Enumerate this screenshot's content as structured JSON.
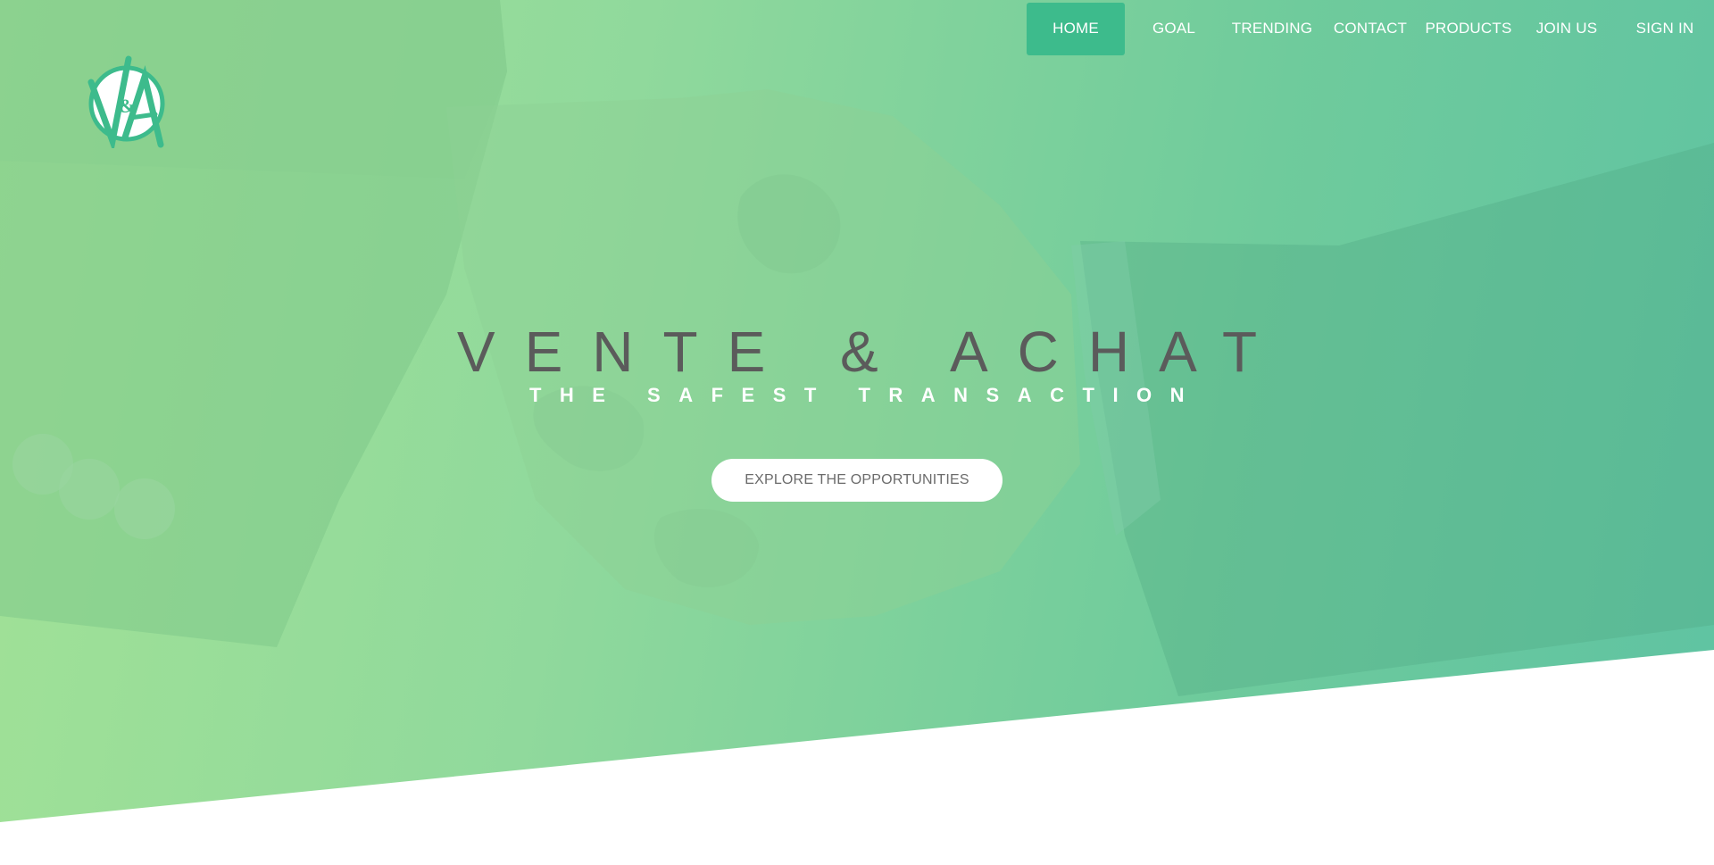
{
  "header": {
    "logo_text": "V&A",
    "nav": [
      {
        "label": "HOME",
        "active": true
      },
      {
        "label": "GOAL",
        "active": false
      },
      {
        "label": "TRENDING",
        "active": false
      },
      {
        "label": "CONTACT",
        "active": false
      },
      {
        "label": "PRODUCTS",
        "active": false
      },
      {
        "label": "JOIN US",
        "active": false
      },
      {
        "label": "SIGN IN",
        "active": false
      }
    ]
  },
  "hero": {
    "title": "VENTE & ACHAT",
    "subtitle": "THE SAFEST TRANSACTION",
    "cta_label": "EXPLORE THE OPPORTUNITIES",
    "background_image": "handshake-photo"
  },
  "colors": {
    "accent": "#3dbb8c",
    "gradient_start": "#a2e296",
    "gradient_end": "#5fc3a2",
    "title_text": "#5b5b5b"
  }
}
